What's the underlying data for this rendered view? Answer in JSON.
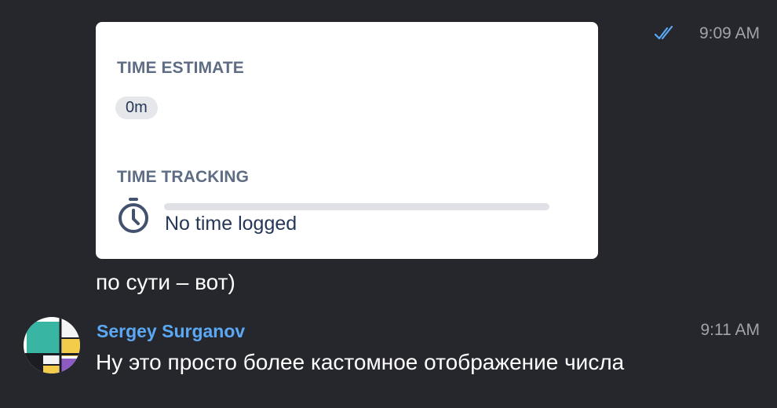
{
  "card": {
    "estimate_title": "TIME ESTIMATE",
    "estimate_value": "0m",
    "tracking_title": "TIME TRACKING",
    "tracking_status": "No time logged",
    "tracking_progress": 0
  },
  "messages": [
    {
      "time": "9:09 AM",
      "status_icon": "double-check-icon",
      "text": "по сути – вот)"
    },
    {
      "author": "Sergey Surganov",
      "time": "9:11 AM",
      "text": "Ну это просто более кастомное отображение числа"
    }
  ],
  "colors": {
    "background": "#26272d",
    "card_bg": "#ffffff",
    "card_label": "#5e6c84",
    "author": "#5ba8f4",
    "timestamp": "#a1a3aa",
    "read_check": "#5ba8f4"
  }
}
